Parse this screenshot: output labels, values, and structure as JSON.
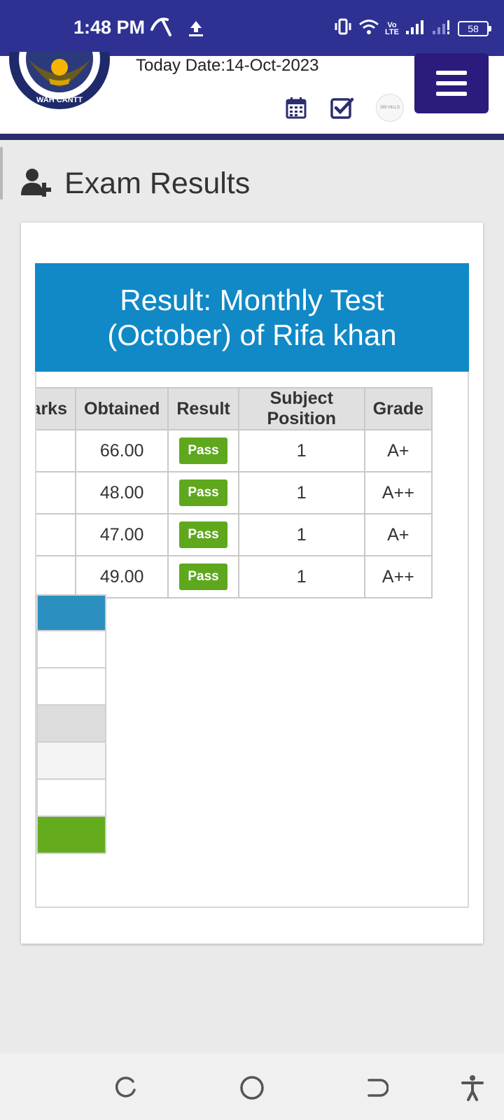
{
  "status_bar": {
    "time": "1:48 PM",
    "battery": "58",
    "volte": "Vo\nLTE",
    "icons": [
      "carrier-icon",
      "upload-icon",
      "vibrate-icon",
      "wifi-icon",
      "signal-icon",
      "signal-icon-2"
    ]
  },
  "header": {
    "today_date": "Today Date:14-Oct-2023",
    "logo_text": "WAH CANTT",
    "school_badge_text": "SRI HILLS"
  },
  "page": {
    "title": "Exam Results"
  },
  "result": {
    "banner": "Result: Monthly Test (October) of Rifa khan",
    "columns": [
      "arks",
      "Obtained",
      "Result",
      "Subject Position",
      "Grade"
    ],
    "rows": [
      {
        "marks": "",
        "obtained": "66.00",
        "result": "Pass",
        "position": "1",
        "grade": "A+"
      },
      {
        "marks": "",
        "obtained": "48.00",
        "result": "Pass",
        "position": "1",
        "grade": "A++"
      },
      {
        "marks": "",
        "obtained": "47.00",
        "result": "Pass",
        "position": "1",
        "grade": "A+"
      },
      {
        "marks": "",
        "obtained": "49.00",
        "result": "Pass",
        "position": "1",
        "grade": "A++"
      }
    ]
  },
  "legend_colors": [
    "#2b90c0",
    "#ffffff",
    "#ffffff",
    "#dcdcdc",
    "#f4f4f4",
    "#ffffff",
    "#64ac1e"
  ],
  "colors": {
    "status_bar": "#2e3192",
    "menu_button": "#2b1b7c",
    "banner": "#1089c6",
    "pass_badge": "#5fa81e"
  }
}
